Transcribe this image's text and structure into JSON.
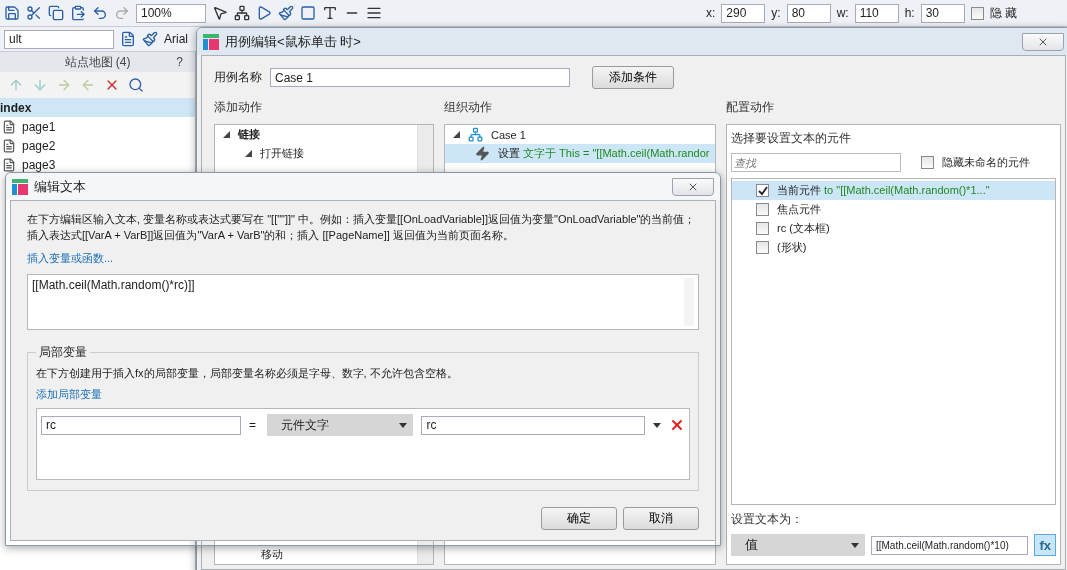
{
  "toolbar": {
    "zoom": "100%",
    "position": [
      {
        "label": "x:",
        "value": "290"
      },
      {
        "label": "y:",
        "value": "80"
      },
      {
        "label": "w:",
        "value": "110"
      },
      {
        "label": "h:",
        "value": "30"
      }
    ],
    "hidden": {
      "label": "隐 藏",
      "checked": false
    }
  },
  "format_bar": {
    "style": "ult",
    "font": "Arial"
  },
  "sitemap": {
    "title": "站点地图 (4)",
    "help": "?",
    "pages": [
      {
        "label": "index",
        "selected": true
      },
      {
        "label": "page1",
        "selected": false
      },
      {
        "label": "page2",
        "selected": false
      },
      {
        "label": "page3",
        "selected": false
      }
    ]
  },
  "case_dialog": {
    "title": "用例编辑<鼠标单击 时>",
    "case_name_label": "用例名称",
    "case_name": "Case 1",
    "add_condition": "添加条件",
    "add_actions": {
      "heading": "添加动作",
      "items": [
        {
          "label": "链接",
          "expanded": true,
          "children": [
            {
              "label": "打开链接",
              "expanded": true
            }
          ]
        }
      ],
      "trailing_item": "移动"
    },
    "organize": {
      "heading": "组织动作",
      "case": {
        "label": "Case 1",
        "expanded": true,
        "actions": [
          {
            "verb": "设置",
            "detail": "文字于 This = \"[[Math.ceil(Math.randor",
            "selected": true
          }
        ]
      }
    },
    "configure": {
      "heading": "配置动作",
      "subheading": "选择要设置文本的元件",
      "search_placeholder": "查找",
      "hide_unnamed": {
        "label": "隐藏未命名的元件",
        "checked": false
      },
      "widgets": [
        {
          "label": "当前元件",
          "value": " to \"[[Math.ceil(Math.random()*1...\"",
          "checked": true,
          "selected": true
        },
        {
          "label": "焦点元件",
          "checked": false,
          "selected": false
        },
        {
          "label": "rc (文本框)",
          "checked": false,
          "selected": false
        },
        {
          "label": "(形状)",
          "checked": false,
          "selected": false
        }
      ],
      "set_text_label": "设置文本为：",
      "set_text_type": "值",
      "set_text_value": "[[Math.ceil(Math.random()*10)",
      "fx": "fx"
    }
  },
  "edit_dialog": {
    "title": "编辑文本",
    "description": "在下方编辑区输入文本, 变量名称或表达式要写在 \"[[\"\"]]\" 中。例如：插入变量[[OnLoadVariable]]返回值为变量\"OnLoadVariable\"的当前值；插入表达式[[VarA + VarB]]返回值为\"VarA + VarB\"的和；插入 [[PageName]] 返回值为当前页面名称。",
    "insert_link": "插入变量或函数...",
    "expression": "[[Math.ceil(Math.random()*rc)]]",
    "local_vars": {
      "title": "局部变量",
      "description": "在下方创建用于插入fx的局部变量，局部变量名称必须是字母、数字, 不允许包含空格。",
      "add_link": "添加局部变量",
      "rows": [
        {
          "name": "rc",
          "equals": "=",
          "type": "元件文字",
          "target": "rc"
        }
      ]
    },
    "buttons": [
      "确定",
      "取消"
    ]
  }
}
